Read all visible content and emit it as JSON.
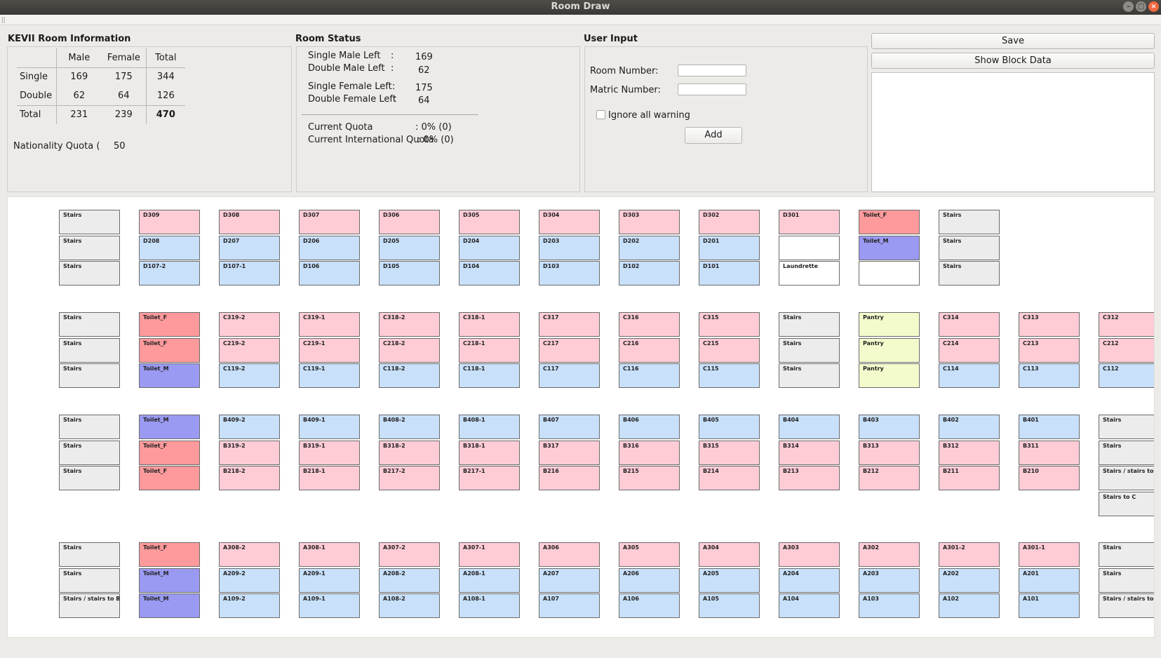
{
  "window": {
    "title": "Room Draw",
    "buttons": [
      "–",
      "□",
      "×"
    ]
  },
  "room_info": {
    "title": "KEVII Room Information",
    "headers": [
      "Male",
      "Female",
      "Total"
    ],
    "rows": [
      {
        "label": "Single",
        "male": "169",
        "female": "175",
        "total": "344"
      },
      {
        "label": "Double",
        "male": "62",
        "female": "64",
        "total": "126"
      },
      {
        "label": "Total",
        "male": "231",
        "female": "239",
        "total": "470"
      }
    ],
    "quota_label": "Nationality Quota (",
    "quota_value": "50"
  },
  "room_status": {
    "title": "Room Status",
    "single_male_label": "Single Male Left",
    "single_male_value": "169",
    "double_male_label": "Double Male Left",
    "double_male_value": "62",
    "single_female_label": "Single Female Left",
    "single_female_value": "175",
    "double_female_label": "Double Female Left",
    "double_female_value": "64",
    "colon": ":",
    "current_quota_label": "Current Quota",
    "current_quota_value": ": 0% (0)",
    "intl_quota_label": "Current International Quota",
    "intl_quota_value": ": 0% (0)"
  },
  "user_input": {
    "title": "User Input",
    "room_label": "Room Number:",
    "room_value": "",
    "matric_label": "Matric Number:",
    "matric_value": "",
    "ignore_label": "Ignore all warning",
    "add_label": "Add"
  },
  "actions": {
    "save_label": "Save",
    "block_label": "Show Block Data"
  },
  "colors": {
    "stairs": "#ececec",
    "female": "#ffccd6",
    "male": "#c8e0fa",
    "toilet_f": "#ff9a9c",
    "toilet_m": "#9a9af2",
    "pantry": "#f3fbcc",
    "white": "#ffffff"
  },
  "blocks": [
    {
      "name": "D",
      "rows": [
        [
          [
            "Stairs",
            "stairs"
          ],
          [
            "D309",
            "female"
          ],
          [
            "D308",
            "female"
          ],
          [
            "D307",
            "female"
          ],
          [
            "D306",
            "female"
          ],
          [
            "D305",
            "female"
          ],
          [
            "D304",
            "female"
          ],
          [
            "D303",
            "female"
          ],
          [
            "D302",
            "female"
          ],
          [
            "D301",
            "female"
          ],
          [
            "Toilet_F",
            "toiletf"
          ],
          [
            "Stairs",
            "stairs"
          ]
        ],
        [
          [
            "Stairs",
            "stairs"
          ],
          [
            "D208",
            "male"
          ],
          [
            "D207",
            "male"
          ],
          [
            "D206",
            "male"
          ],
          [
            "D205",
            "male"
          ],
          [
            "D204",
            "male"
          ],
          [
            "D203",
            "male"
          ],
          [
            "D202",
            "male"
          ],
          [
            "D201",
            "male"
          ],
          [
            "",
            "white"
          ],
          [
            "Toilet_M",
            "toiletm"
          ],
          [
            "Stairs",
            "stairs"
          ]
        ],
        [
          [
            "Stairs",
            "stairs"
          ],
          [
            "D107-2",
            "male"
          ],
          [
            "D107-1",
            "male"
          ],
          [
            "D106",
            "male"
          ],
          [
            "D105",
            "male"
          ],
          [
            "D104",
            "male"
          ],
          [
            "D103",
            "male"
          ],
          [
            "D102",
            "male"
          ],
          [
            "D101",
            "male"
          ],
          [
            "Laundrette",
            "white"
          ],
          [
            "",
            "white"
          ],
          [
            "Stairs",
            "stairs"
          ]
        ]
      ]
    },
    {
      "name": "C",
      "rows": [
        [
          [
            "Stairs",
            "stairs"
          ],
          [
            "Toilet_F",
            "toiletf"
          ],
          [
            "C319-2",
            "female"
          ],
          [
            "C319-1",
            "female"
          ],
          [
            "C318-2",
            "female"
          ],
          [
            "C318-1",
            "female"
          ],
          [
            "C317",
            "female"
          ],
          [
            "C316",
            "female"
          ],
          [
            "C315",
            "female"
          ],
          [
            "Stairs",
            "stairs"
          ],
          [
            "Pantry",
            "pantry"
          ],
          [
            "C314",
            "female"
          ],
          [
            "C313",
            "female"
          ],
          [
            "C312",
            "female"
          ]
        ],
        [
          [
            "Stairs",
            "stairs"
          ],
          [
            "Toilet_F",
            "toiletf"
          ],
          [
            "C219-2",
            "female"
          ],
          [
            "C219-1",
            "female"
          ],
          [
            "C218-2",
            "female"
          ],
          [
            "C218-1",
            "female"
          ],
          [
            "C217",
            "female"
          ],
          [
            "C216",
            "female"
          ],
          [
            "C215",
            "female"
          ],
          [
            "Stairs",
            "stairs"
          ],
          [
            "Pantry",
            "pantry"
          ],
          [
            "C214",
            "female"
          ],
          [
            "C213",
            "female"
          ],
          [
            "C212",
            "female"
          ]
        ],
        [
          [
            "Stairs",
            "stairs"
          ],
          [
            "Toilet_M",
            "toiletm"
          ],
          [
            "C119-2",
            "male"
          ],
          [
            "C119-1",
            "male"
          ],
          [
            "C118-2",
            "male"
          ],
          [
            "C118-1",
            "male"
          ],
          [
            "C117",
            "male"
          ],
          [
            "C116",
            "male"
          ],
          [
            "C115",
            "male"
          ],
          [
            "Stairs",
            "stairs"
          ],
          [
            "Pantry",
            "pantry"
          ],
          [
            "C114",
            "male"
          ],
          [
            "C113",
            "male"
          ],
          [
            "C112",
            "male"
          ]
        ]
      ]
    },
    {
      "name": "B",
      "rows": [
        [
          [
            "Stairs",
            "stairs"
          ],
          [
            "Toilet_M",
            "toiletm"
          ],
          [
            "B409-2",
            "male"
          ],
          [
            "B409-1",
            "male"
          ],
          [
            "B408-2",
            "male"
          ],
          [
            "B408-1",
            "male"
          ],
          [
            "B407",
            "male"
          ],
          [
            "B406",
            "male"
          ],
          [
            "B405",
            "male"
          ],
          [
            "B404",
            "male"
          ],
          [
            "B403",
            "male"
          ],
          [
            "B402",
            "male"
          ],
          [
            "B401",
            "male"
          ],
          [
            "Stairs",
            "stairs"
          ]
        ],
        [
          [
            "Stairs",
            "stairs"
          ],
          [
            "Toilet_F",
            "toiletf"
          ],
          [
            "B319-2",
            "female"
          ],
          [
            "B319-1",
            "female"
          ],
          [
            "B318-2",
            "female"
          ],
          [
            "B318-1",
            "female"
          ],
          [
            "B317",
            "female"
          ],
          [
            "B316",
            "female"
          ],
          [
            "B315",
            "female"
          ],
          [
            "B314",
            "female"
          ],
          [
            "B313",
            "female"
          ],
          [
            "B312",
            "female"
          ],
          [
            "B311",
            "female"
          ],
          [
            "Stairs",
            "stairs"
          ]
        ],
        [
          [
            "Stairs",
            "stairs"
          ],
          [
            "Toilet_F",
            "toiletf"
          ],
          [
            "B218-2",
            "female"
          ],
          [
            "B218-1",
            "female"
          ],
          [
            "B217-2",
            "female"
          ],
          [
            "B217-1",
            "female"
          ],
          [
            "B216",
            "female"
          ],
          [
            "B215",
            "female"
          ],
          [
            "B214",
            "female"
          ],
          [
            "B213",
            "female"
          ],
          [
            "B212",
            "female"
          ],
          [
            "B211",
            "female"
          ],
          [
            "B210",
            "female"
          ],
          [
            "Stairs / stairs to",
            "stairs"
          ]
        ],
        [
          null,
          null,
          null,
          null,
          null,
          null,
          null,
          null,
          null,
          null,
          null,
          null,
          null,
          [
            "Stairs to C",
            "stairs"
          ]
        ]
      ]
    },
    {
      "name": "A",
      "rows": [
        [
          [
            "Stairs",
            "stairs"
          ],
          [
            "Toilet_F",
            "toiletf"
          ],
          [
            "A308-2",
            "female"
          ],
          [
            "A308-1",
            "female"
          ],
          [
            "A307-2",
            "female"
          ],
          [
            "A307-1",
            "female"
          ],
          [
            "A306",
            "female"
          ],
          [
            "A305",
            "female"
          ],
          [
            "A304",
            "female"
          ],
          [
            "A303",
            "female"
          ],
          [
            "A302",
            "female"
          ],
          [
            "A301-2",
            "female"
          ],
          [
            "A301-1",
            "female"
          ],
          [
            "Stairs",
            "stairs"
          ]
        ],
        [
          [
            "Stairs",
            "stairs"
          ],
          [
            "Toilet_M",
            "toiletm"
          ],
          [
            "A209-2",
            "male"
          ],
          [
            "A209-1",
            "male"
          ],
          [
            "A208-2",
            "male"
          ],
          [
            "A208-1",
            "male"
          ],
          [
            "A207",
            "male"
          ],
          [
            "A206",
            "male"
          ],
          [
            "A205",
            "male"
          ],
          [
            "A204",
            "male"
          ],
          [
            "A203",
            "male"
          ],
          [
            "A202",
            "male"
          ],
          [
            "A201",
            "male"
          ],
          [
            "Stairs",
            "stairs"
          ]
        ],
        [
          [
            "Stairs / stairs to B",
            "stairs"
          ],
          [
            "Toilet_M",
            "toiletm"
          ],
          [
            "A109-2",
            "male"
          ],
          [
            "A109-1",
            "male"
          ],
          [
            "A108-2",
            "male"
          ],
          [
            "A108-1",
            "male"
          ],
          [
            "A107",
            "male"
          ],
          [
            "A106",
            "male"
          ],
          [
            "A105",
            "male"
          ],
          [
            "A104",
            "male"
          ],
          [
            "A103",
            "male"
          ],
          [
            "A102",
            "male"
          ],
          [
            "A101",
            "male"
          ],
          [
            "Stairs / stairs to",
            "stairs"
          ]
        ]
      ]
    }
  ]
}
